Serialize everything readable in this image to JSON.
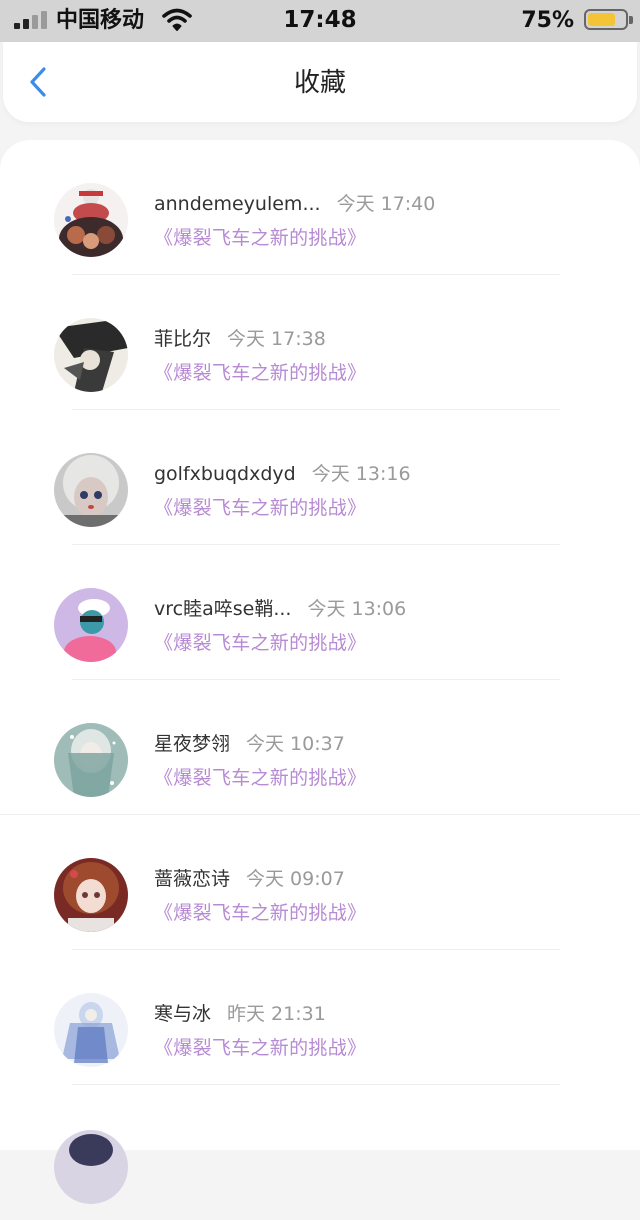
{
  "status_bar": {
    "carrier": "中国移动",
    "time": "17:48",
    "battery_percent": "75%",
    "battery_level": 0.75,
    "battery_color": "#f2c436",
    "wifi_icon": "wifi-icon",
    "signal_icon": "signal-bars-icon"
  },
  "header": {
    "back_icon": "chevron-left-icon",
    "title": "收藏",
    "accent_color": "#3d8de8"
  },
  "favorites": [
    {
      "name": "anndemeyulem...",
      "time": "今天 17:40",
      "game": "《爆裂飞车之新的挑战》"
    },
    {
      "name": "菲比尔",
      "time": "今天 17:38",
      "game": "《爆裂飞车之新的挑战》"
    },
    {
      "name": "golfxbuqdxdyd",
      "time": "今天 13:16",
      "game": "《爆裂飞车之新的挑战》"
    },
    {
      "name": "vrc睦a啐se鞘...",
      "time": "今天 13:06",
      "game": "《爆裂飞车之新的挑战》"
    },
    {
      "name": "星夜梦翎",
      "time": "今天 10:37",
      "game": "《爆裂飞车之新的挑战》"
    },
    {
      "name": "蔷薇恋诗",
      "time": "今天 09:07",
      "game": "《爆裂飞车之新的挑战》"
    },
    {
      "name": "寒与冰",
      "time": "昨天 21:31",
      "game": "《爆裂飞车之新的挑战》"
    }
  ],
  "colors": {
    "game_title": "#b78ad4",
    "timestamp": "#9a9a9a",
    "name": "#333333"
  }
}
